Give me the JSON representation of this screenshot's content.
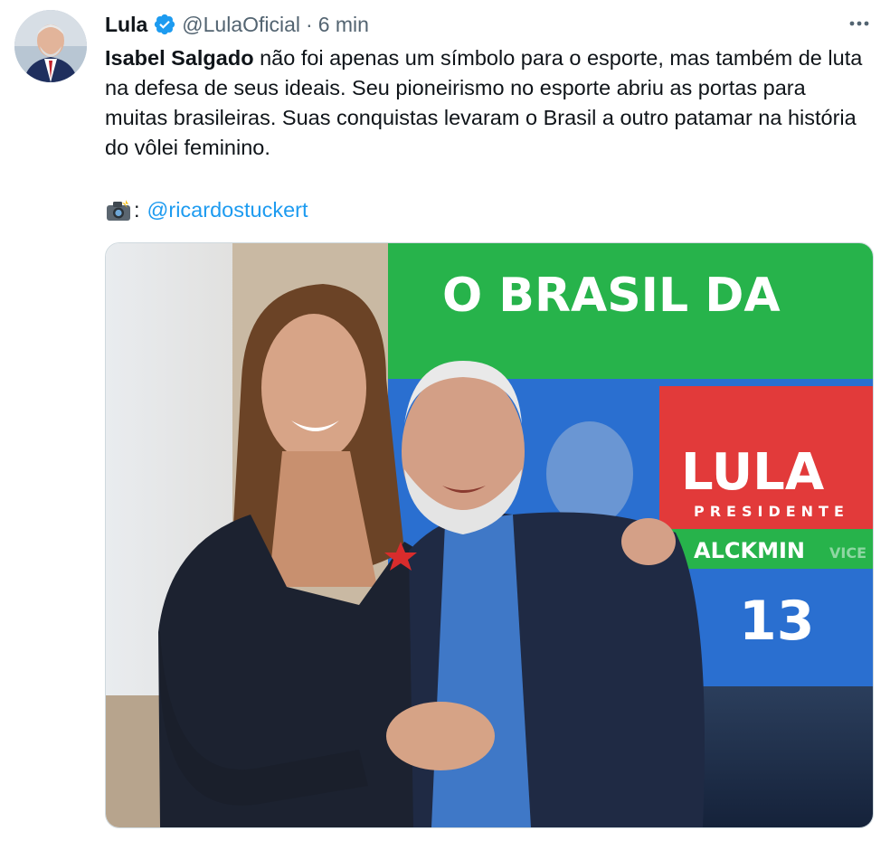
{
  "author": {
    "name": "Lula",
    "handle": "@LulaOficial",
    "separator": "·",
    "time": "6 min"
  },
  "tweet": {
    "bold_lead": "Isabel Salgado",
    "body": " não foi apenas um símbolo para o esporte, mas também de luta na defesa de seus ideais. Seu pioneirismo no esporte abriu as portas para muitas brasileiras. Suas conquistas levaram o Brasil a outro patamar na história do vôlei feminino.",
    "credit_suffix": ":",
    "credit_link": "@ricardostuckert"
  },
  "photo": {
    "banner_line": "O BRASIL DA",
    "poster_name": "LULA",
    "poster_title": "PRESIDENTE",
    "poster_vice": "ALCKMIN",
    "poster_vice_suffix": "VICE",
    "poster_number": "13"
  },
  "icons": {
    "verified": "verified-badge-icon",
    "more": "more-options-icon",
    "camera": "camera-flash-emoji"
  },
  "colors": {
    "link": "#1d9bf0",
    "verified": "#1d9bf0",
    "muted": "#536471",
    "banner_green": "#26b34a",
    "poster_red": "#e23a3a",
    "poster_blue": "#1d6fd6"
  }
}
